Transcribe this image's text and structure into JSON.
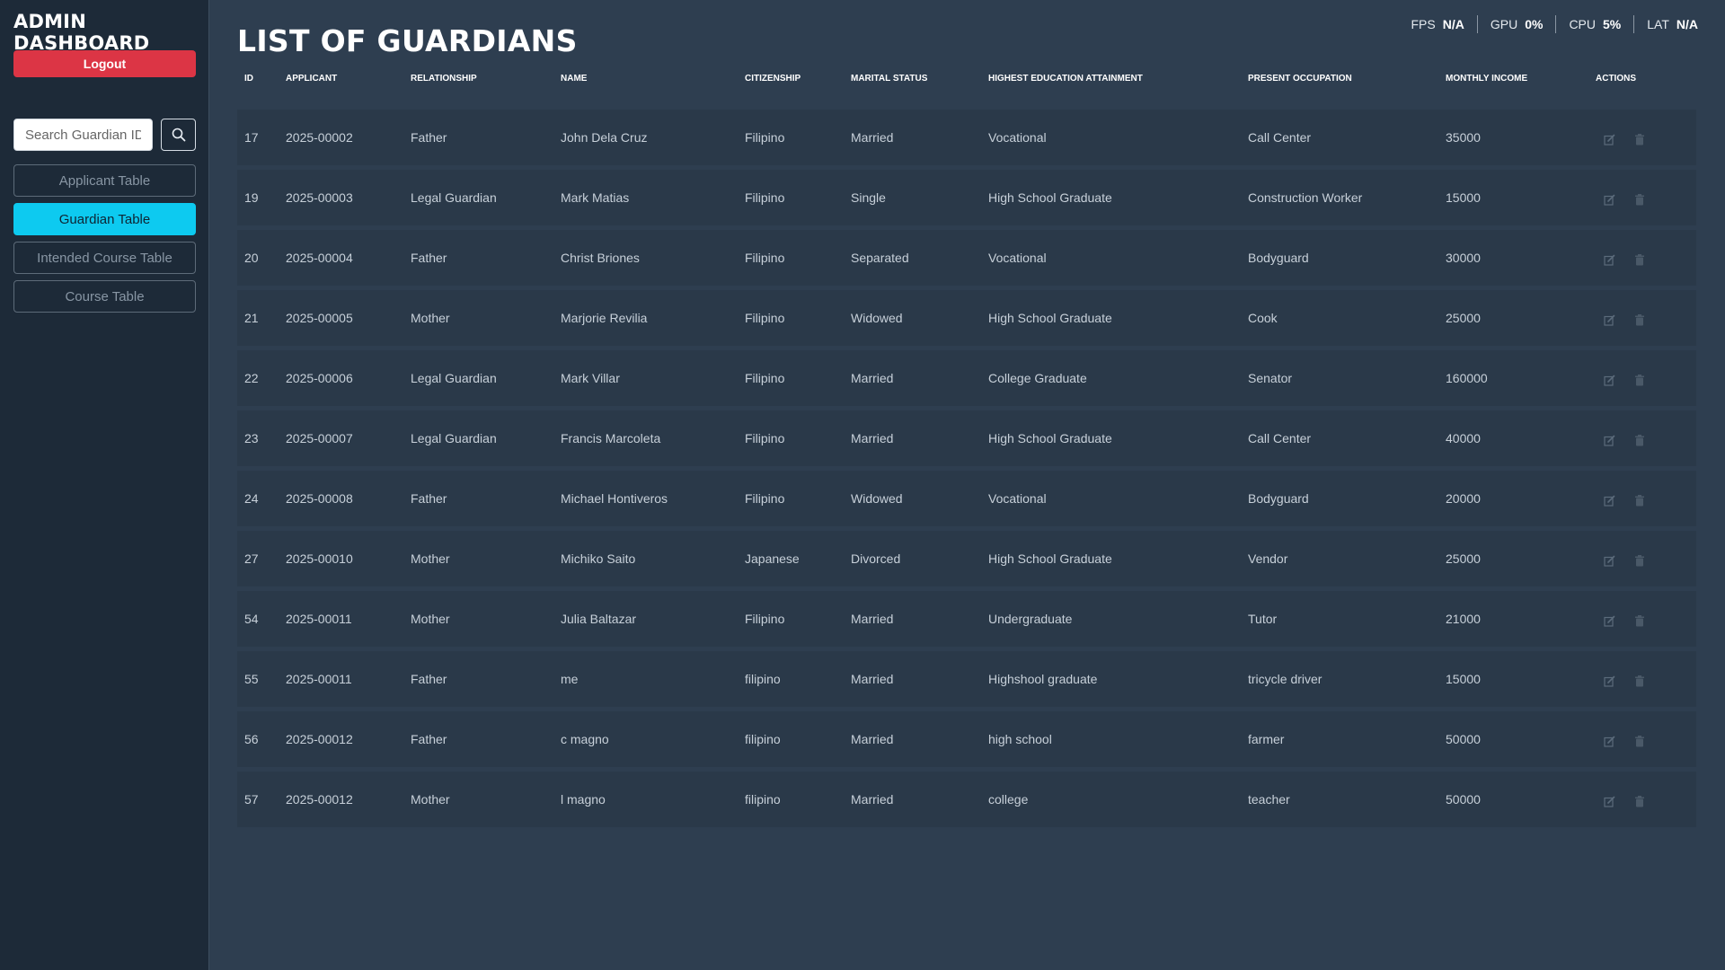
{
  "sidebar": {
    "brand": "ADMIN DASHBOARD",
    "logout_label": "Logout",
    "search_placeholder": "Search Guardian ID...",
    "nav": [
      {
        "label": "Applicant Table",
        "active": false
      },
      {
        "label": "Guardian Table",
        "active": true
      },
      {
        "label": "Intended Course Table",
        "active": false
      },
      {
        "label": "Course Table",
        "active": false
      }
    ]
  },
  "header": {
    "title": "LIST OF GUARDIANS"
  },
  "stats": {
    "fps_label": "FPS",
    "fps_value": "N/A",
    "gpu_label": "GPU",
    "gpu_value": "0%",
    "cpu_label": "CPU",
    "cpu_value": "5%",
    "lat_label": "LAT",
    "lat_value": "N/A"
  },
  "table": {
    "columns": [
      "ID",
      "APPLICANT",
      "RELATIONSHIP",
      "NAME",
      "CITIZENSHIP",
      "MARITAL STATUS",
      "HIGHEST EDUCATION ATTAINMENT",
      "PRESENT OCCUPATION",
      "MONTHLY INCOME",
      "ACTIONS"
    ],
    "rows": [
      [
        "17",
        "2025-00002",
        "Father",
        "John Dela Cruz",
        "Filipino",
        "Married",
        "Vocational",
        "Call Center",
        "35000"
      ],
      [
        "19",
        "2025-00003",
        "Legal Guardian",
        "Mark Matias",
        "Filipino",
        "Single",
        "High School Graduate",
        "Construction Worker",
        "15000"
      ],
      [
        "20",
        "2025-00004",
        "Father",
        "Christ Briones",
        "Filipino",
        "Separated",
        "Vocational",
        "Bodyguard",
        "30000"
      ],
      [
        "21",
        "2025-00005",
        "Mother",
        "Marjorie Revilia",
        "Filipino",
        "Widowed",
        "High School Graduate",
        "Cook",
        "25000"
      ],
      [
        "22",
        "2025-00006",
        "Legal Guardian",
        "Mark Villar",
        "Filipino",
        "Married",
        "College Graduate",
        "Senator",
        "160000"
      ],
      [
        "23",
        "2025-00007",
        "Legal Guardian",
        "Francis Marcoleta",
        "Filipino",
        "Married",
        "High School Graduate",
        "Call Center",
        "40000"
      ],
      [
        "24",
        "2025-00008",
        "Father",
        "Michael Hontiveros",
        "Filipino",
        "Widowed",
        "Vocational",
        "Bodyguard",
        "20000"
      ],
      [
        "27",
        "2025-00010",
        "Mother",
        "Michiko Saito",
        "Japanese",
        "Divorced",
        "High School Graduate",
        "Vendor",
        "25000"
      ],
      [
        "54",
        "2025-00011",
        "Mother",
        "Julia Baltazar",
        "Filipino",
        "Married",
        "Undergraduate",
        "Tutor",
        "21000"
      ],
      [
        "55",
        "2025-00011",
        "Father",
        "me",
        "filipino",
        "Married",
        "Highshool graduate",
        "tricycle driver",
        "15000"
      ],
      [
        "56",
        "2025-00012",
        "Father",
        "c magno",
        "filipino",
        "Married",
        "high school",
        "farmer",
        "50000"
      ],
      [
        "57",
        "2025-00012",
        "Mother",
        "l magno",
        "filipino",
        "Married",
        "college",
        "teacher",
        "50000"
      ]
    ],
    "row_actions": {
      "edit_icon": "edit-icon",
      "delete_icon": "trash-icon"
    }
  },
  "colors": {
    "background": "#2e3e50",
    "sidebar": "#1d2a38",
    "logout": "#dc3545",
    "active_nav": "#0dcaf0",
    "row": "#2a3949"
  }
}
